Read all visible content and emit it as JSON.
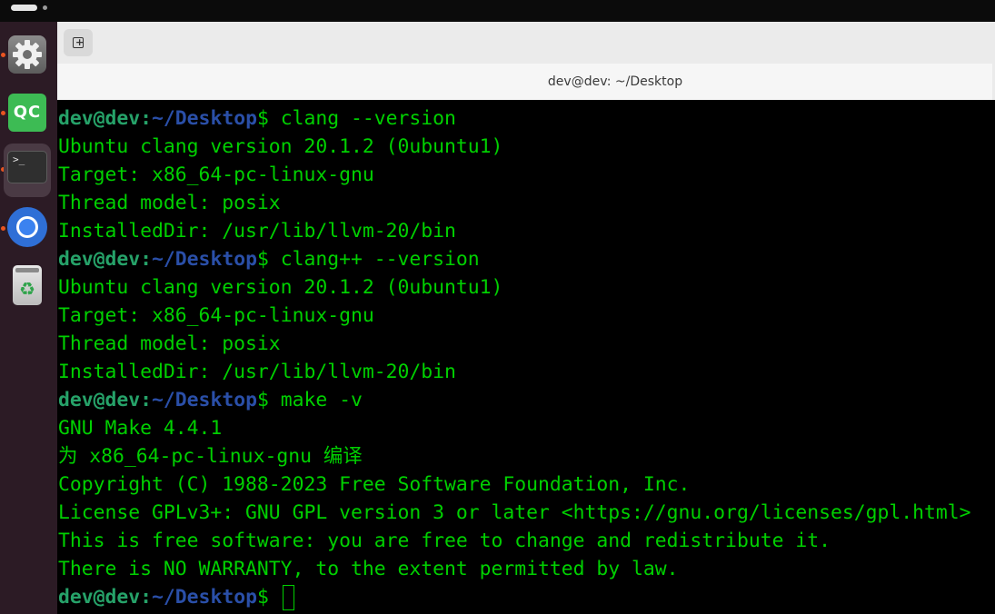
{
  "window": {
    "title": "dev@dev: ~/Desktop"
  },
  "dock": {
    "apps": [
      {
        "name": "Settings",
        "icon": "gear-icon",
        "running": true
      },
      {
        "name": "Qt Creator",
        "icon": "qt-creator-icon",
        "label": "QC",
        "running": true
      },
      {
        "name": "Terminal",
        "icon": "terminal-icon",
        "label": ">_",
        "running": true,
        "active": true
      },
      {
        "name": "Chromium",
        "icon": "chromium-icon",
        "running": true
      },
      {
        "name": "Trash",
        "icon": "trash-icon",
        "running": false
      }
    ]
  },
  "prompt": {
    "user": "dev@dev",
    "colon": ":",
    "path": "~/Desktop",
    "symbol": "$"
  },
  "terminal": {
    "lines": [
      {
        "type": "prompt",
        "command": " clang --version"
      },
      {
        "type": "output",
        "text": "Ubuntu clang version 20.1.2 (0ubuntu1)"
      },
      {
        "type": "output",
        "text": "Target: x86_64-pc-linux-gnu"
      },
      {
        "type": "output",
        "text": "Thread model: posix"
      },
      {
        "type": "output",
        "text": "InstalledDir: /usr/lib/llvm-20/bin"
      },
      {
        "type": "prompt",
        "command": " clang++ --version"
      },
      {
        "type": "output",
        "text": "Ubuntu clang version 20.1.2 (0ubuntu1)"
      },
      {
        "type": "output",
        "text": "Target: x86_64-pc-linux-gnu"
      },
      {
        "type": "output",
        "text": "Thread model: posix"
      },
      {
        "type": "output",
        "text": "InstalledDir: /usr/lib/llvm-20/bin"
      },
      {
        "type": "prompt",
        "command": " make -v"
      },
      {
        "type": "output",
        "text": "GNU Make 4.4.1"
      },
      {
        "type": "output",
        "text": "为 x86_64-pc-linux-gnu 编译"
      },
      {
        "type": "output",
        "text": "Copyright (C) 1988-2023 Free Software Foundation, Inc."
      },
      {
        "type": "output",
        "text": "License GPLv3+: GNU GPL version 3 or later <https://gnu.org/licenses/gpl.html>"
      },
      {
        "type": "output",
        "text": "This is free software: you are free to change and redistribute it."
      },
      {
        "type": "output",
        "text": "There is NO WARRANTY, to the extent permitted by law."
      },
      {
        "type": "prompt",
        "command": " ",
        "cursor": true
      }
    ]
  },
  "colors": {
    "output": "#00d000",
    "prompt_user": "#26a269",
    "prompt_path": "#2a4fa8",
    "dock_bg": "#2c1b25",
    "running_indicator": "#e95420"
  }
}
